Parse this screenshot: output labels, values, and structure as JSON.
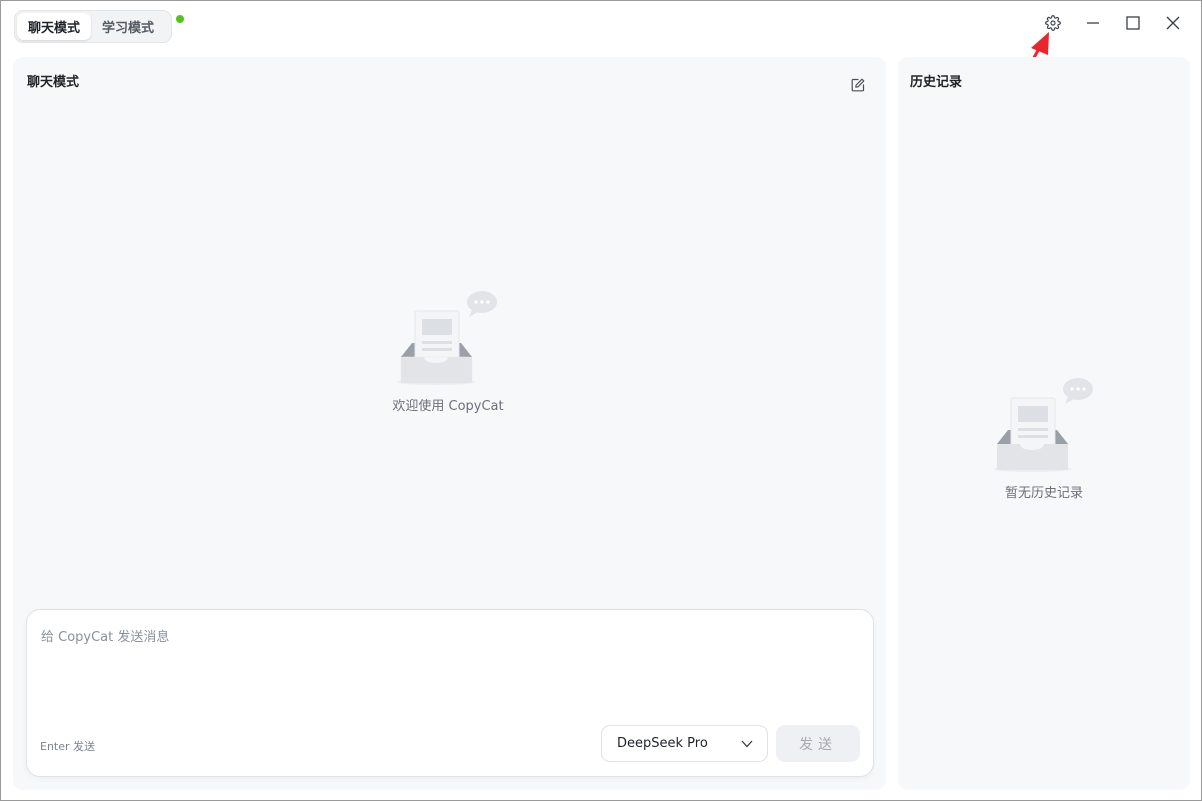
{
  "titlebar": {
    "modes": [
      {
        "label": "聊天模式",
        "active": true
      },
      {
        "label": "学习模式",
        "active": false
      }
    ],
    "status_color": "#52c41a",
    "icons": [
      "gear-icon",
      "minimize-icon",
      "maximize-icon",
      "close-icon"
    ]
  },
  "chat": {
    "title": "聊天模式",
    "empty_text": "欢迎使用 CopyCat",
    "composer": {
      "placeholder": "给 CopyCat 发送消息",
      "value": "",
      "enter_hint": "Enter 发送",
      "model": "DeepSeek Pro",
      "send_label": "发送"
    }
  },
  "history": {
    "title": "历史记录",
    "empty_text": "暂无历史记录"
  },
  "colors": {
    "accent_status": "#52c41a",
    "annotation_arrow": "#e8262b",
    "panel_bg": "#f7f8fa"
  }
}
